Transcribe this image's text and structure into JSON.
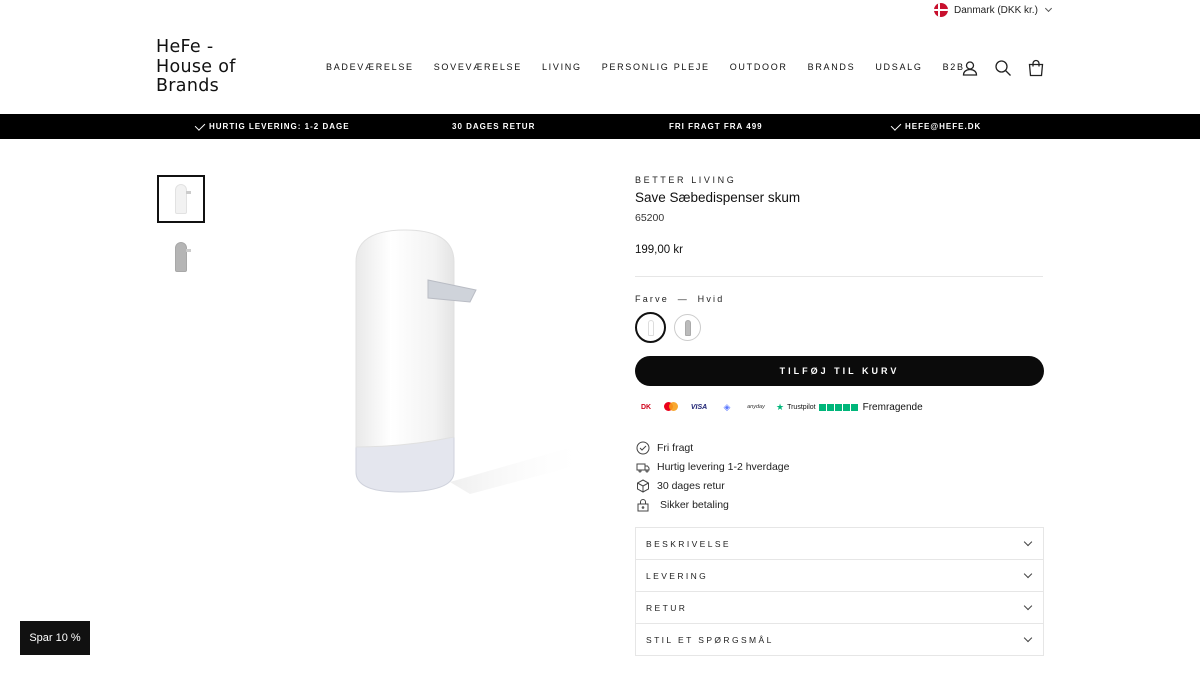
{
  "locale": {
    "label": "Danmark (DKK kr.)",
    "icon": "danish-flag-icon"
  },
  "logo": {
    "line1": "HeFe -",
    "line2": "House of",
    "line3": "Brands"
  },
  "nav": [
    "BADEVÆRELSE",
    "SOVEVÆRELSE",
    "LIVING",
    "PERSONLIG PLEJE",
    "OUTDOOR",
    "BRANDS",
    "UDSALG",
    "B2B"
  ],
  "header_icons": [
    "account-icon",
    "search-icon",
    "cart-icon"
  ],
  "announcements": [
    "HURTIG LEVERING: 1-2 DAGE",
    "30 DAGES RETUR",
    "FRI FRAGT FRA 499",
    "HEFE@HEFE.DK"
  ],
  "product": {
    "brand": "BETTER LIVING",
    "title": "Save Sæbedispenser skum",
    "sku": "65200",
    "price": "199,00 kr",
    "variant_label": "Farve",
    "variant_sep": "—",
    "variant_value": "Hvid",
    "add_to_cart": "TILFØJ TIL KURV"
  },
  "payments": {
    "dankort": "DK",
    "visa": "VISA",
    "mobilepay": "◈",
    "anyday": "anyday",
    "trustpilot": "Trustpilot",
    "rating_text": "Fremragende"
  },
  "perks": [
    "Fri fragt",
    "Hurtig levering 1-2 hverdage",
    "30 dages retur",
    "Sikker betaling"
  ],
  "accordions": [
    "BESKRIVELSE",
    "LEVERING",
    "RETUR",
    "STIL ET SPØRGSMÅL"
  ],
  "promo": "Spar 10 %",
  "colors": {
    "accent": "#000000",
    "trustpilot_green": "#00b67a",
    "flag_red": "#c8102e"
  }
}
